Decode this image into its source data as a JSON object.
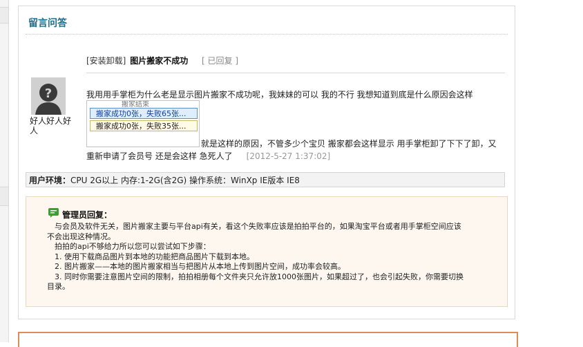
{
  "panel": {
    "title": "留言问答"
  },
  "question": {
    "category": "[安装卸载]",
    "title": "图片搬家不成功",
    "status": "[ 已回复 ]",
    "username": "好人好人好人",
    "body_line1": "我用用手掌柜为什么老是显示图片搬家不成功呢，我妹妹的可以 我的不行 我想知道到底是什么原因会这样",
    "body_line2_suffix": "就是这样的原因，不管多少个宝贝 搬家都会这样显示 用手掌柜卸了下下了卸，又",
    "body_line3": "重新申请了会员号 还是会这样 急死人了",
    "time": "[2012-5-27 1:37:02]",
    "screenshot": {
      "peek": "搬家结束",
      "rows": [
        "搬家成功0张，失败65张...",
        "搬家成功0张，失败35张..."
      ]
    }
  },
  "environment": {
    "label": "用户环境：",
    "value": "CPU 2G以上 内存:1-2G(含2G) 操作系统：WinXp IE版本 IE8"
  },
  "reply": {
    "title": "管理员回复：",
    "lines": [
      "　与会员及软件无关，图片搬家主要与平台api有关，看这个失败率应该是拍拍平台的，如果淘宝平台或者用手掌柜空间应该",
      "不会出现这种情况。",
      "　拍拍的api不够给力所以您可以尝试如下步骤：",
      "　1. 使用下载商品图片到本地的功能把商品图片下载到本地。",
      "　2. 图片搬家——本地的图片搬家相当与把图片从本地上传到图片空间，成功率会较高。",
      "　3. 同时你需要注意图片空间的限制，拍拍相册每个文件夹只允许放1000张图片，如果超过了，也会引起失败，你需要切换",
      "目录。"
    ]
  },
  "colors": {
    "title": "#1f6e8c",
    "reply_bg": "#fdf7ef",
    "bottom_border": "#e08a5a"
  }
}
